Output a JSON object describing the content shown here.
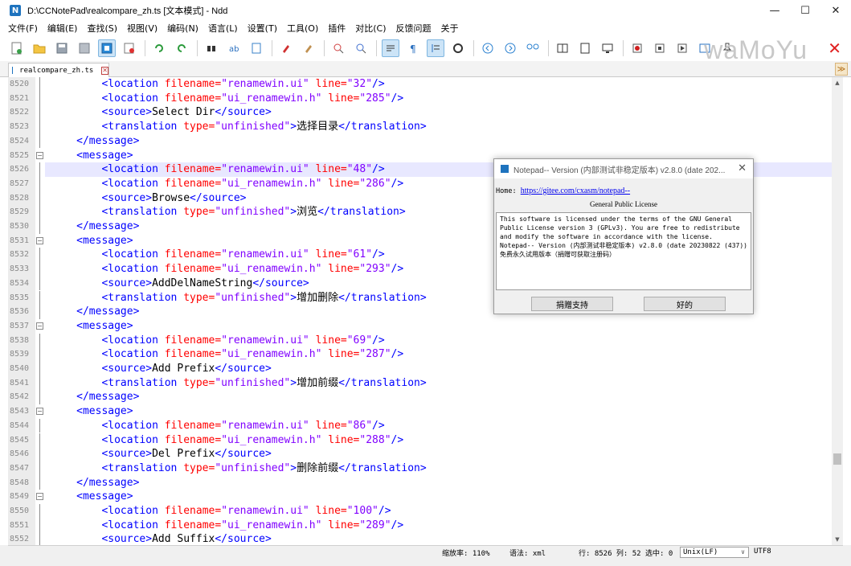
{
  "window": {
    "title": "D:\\CCNotePad\\realcompare_zh.ts [文本模式] - Ndd",
    "minimize": "—",
    "maximize": "☐",
    "close": "✕"
  },
  "menu": [
    "文件(F)",
    "编辑(E)",
    "查找(S)",
    "视图(V)",
    "编码(N)",
    "语言(L)",
    "设置(T)",
    "工具(O)",
    "插件",
    "对比(C)",
    "反馈问题",
    "关于"
  ],
  "watermark": "waMoYu",
  "tab": {
    "label": "realcompare_zh.ts"
  },
  "editor": {
    "lines": [
      {
        "n": "8520",
        "indent": 8,
        "parts": [
          [
            "tag",
            "<location "
          ],
          [
            "attr",
            "filename="
          ],
          [
            "val",
            "\"renamewin.ui\""
          ],
          [
            "attr",
            " line="
          ],
          [
            "val",
            "\"32\""
          ],
          [
            "tag",
            "/>"
          ]
        ]
      },
      {
        "n": "8521",
        "indent": 8,
        "parts": [
          [
            "tag",
            "<location "
          ],
          [
            "attr",
            "filename="
          ],
          [
            "val",
            "\"ui_renamewin.h\""
          ],
          [
            "attr",
            " line="
          ],
          [
            "val",
            "\"285\""
          ],
          [
            "tag",
            "/>"
          ]
        ]
      },
      {
        "n": "8522",
        "indent": 8,
        "parts": [
          [
            "tag",
            "<source>"
          ],
          [
            "txt",
            "Select Dir"
          ],
          [
            "tag",
            "</source>"
          ]
        ]
      },
      {
        "n": "8523",
        "indent": 8,
        "parts": [
          [
            "tag",
            "<translation "
          ],
          [
            "attr",
            "type="
          ],
          [
            "val",
            "\"unfinished\""
          ],
          [
            "tag",
            ">"
          ],
          [
            "txt",
            "选择目录"
          ],
          [
            "tag",
            "</translation>"
          ]
        ]
      },
      {
        "n": "8524",
        "indent": 4,
        "parts": [
          [
            "tag",
            "</message>"
          ]
        ]
      },
      {
        "n": "8525",
        "indent": 4,
        "parts": [
          [
            "tag",
            "<message>"
          ]
        ]
      },
      {
        "n": "8526",
        "indent": 8,
        "parts": [
          [
            "tag",
            "<location "
          ],
          [
            "attr",
            "filename="
          ],
          [
            "val",
            "\"renamewin.ui\""
          ],
          [
            "attr",
            " line="
          ],
          [
            "val",
            "\"48\""
          ],
          [
            "tag",
            "/>"
          ]
        ]
      },
      {
        "n": "8527",
        "indent": 8,
        "parts": [
          [
            "tag",
            "<location "
          ],
          [
            "attr",
            "filename="
          ],
          [
            "val",
            "\"ui_renamewin.h\""
          ],
          [
            "attr",
            " line="
          ],
          [
            "val",
            "\"286\""
          ],
          [
            "tag",
            "/>"
          ]
        ]
      },
      {
        "n": "8528",
        "indent": 8,
        "parts": [
          [
            "tag",
            "<source>"
          ],
          [
            "txt",
            "Browse"
          ],
          [
            "tag",
            "</source>"
          ]
        ]
      },
      {
        "n": "8529",
        "indent": 8,
        "parts": [
          [
            "tag",
            "<translation "
          ],
          [
            "attr",
            "type="
          ],
          [
            "val",
            "\"unfinished\""
          ],
          [
            "tag",
            ">"
          ],
          [
            "txt",
            "浏览"
          ],
          [
            "tag",
            "</translation>"
          ]
        ]
      },
      {
        "n": "8530",
        "indent": 4,
        "parts": [
          [
            "tag",
            "</message>"
          ]
        ]
      },
      {
        "n": "8531",
        "indent": 4,
        "parts": [
          [
            "tag",
            "<message>"
          ]
        ]
      },
      {
        "n": "8532",
        "indent": 8,
        "parts": [
          [
            "tag",
            "<location "
          ],
          [
            "attr",
            "filename="
          ],
          [
            "val",
            "\"renamewin.ui\""
          ],
          [
            "attr",
            " line="
          ],
          [
            "val",
            "\"61\""
          ],
          [
            "tag",
            "/>"
          ]
        ]
      },
      {
        "n": "8533",
        "indent": 8,
        "parts": [
          [
            "tag",
            "<location "
          ],
          [
            "attr",
            "filename="
          ],
          [
            "val",
            "\"ui_renamewin.h\""
          ],
          [
            "attr",
            " line="
          ],
          [
            "val",
            "\"293\""
          ],
          [
            "tag",
            "/>"
          ]
        ]
      },
      {
        "n": "8534",
        "indent": 8,
        "parts": [
          [
            "tag",
            "<source>"
          ],
          [
            "txt",
            "AddDelNameString"
          ],
          [
            "tag",
            "</source>"
          ]
        ]
      },
      {
        "n": "8535",
        "indent": 8,
        "parts": [
          [
            "tag",
            "<translation "
          ],
          [
            "attr",
            "type="
          ],
          [
            "val",
            "\"unfinished\""
          ],
          [
            "tag",
            ">"
          ],
          [
            "txt",
            "增加删除"
          ],
          [
            "tag",
            "</translation>"
          ]
        ]
      },
      {
        "n": "8536",
        "indent": 4,
        "parts": [
          [
            "tag",
            "</message>"
          ]
        ]
      },
      {
        "n": "8537",
        "indent": 4,
        "parts": [
          [
            "tag",
            "<message>"
          ]
        ]
      },
      {
        "n": "8538",
        "indent": 8,
        "parts": [
          [
            "tag",
            "<location "
          ],
          [
            "attr",
            "filename="
          ],
          [
            "val",
            "\"renamewin.ui\""
          ],
          [
            "attr",
            " line="
          ],
          [
            "val",
            "\"69\""
          ],
          [
            "tag",
            "/>"
          ]
        ]
      },
      {
        "n": "8539",
        "indent": 8,
        "parts": [
          [
            "tag",
            "<location "
          ],
          [
            "attr",
            "filename="
          ],
          [
            "val",
            "\"ui_renamewin.h\""
          ],
          [
            "attr",
            " line="
          ],
          [
            "val",
            "\"287\""
          ],
          [
            "tag",
            "/>"
          ]
        ]
      },
      {
        "n": "8540",
        "indent": 8,
        "parts": [
          [
            "tag",
            "<source>"
          ],
          [
            "txt",
            "Add Prefix"
          ],
          [
            "tag",
            "</source>"
          ]
        ]
      },
      {
        "n": "8541",
        "indent": 8,
        "parts": [
          [
            "tag",
            "<translation "
          ],
          [
            "attr",
            "type="
          ],
          [
            "val",
            "\"unfinished\""
          ],
          [
            "tag",
            ">"
          ],
          [
            "txt",
            "增加前缀"
          ],
          [
            "tag",
            "</translation>"
          ]
        ]
      },
      {
        "n": "8542",
        "indent": 4,
        "parts": [
          [
            "tag",
            "</message>"
          ]
        ]
      },
      {
        "n": "8543",
        "indent": 4,
        "parts": [
          [
            "tag",
            "<message>"
          ]
        ]
      },
      {
        "n": "8544",
        "indent": 8,
        "parts": [
          [
            "tag",
            "<location "
          ],
          [
            "attr",
            "filename="
          ],
          [
            "val",
            "\"renamewin.ui\""
          ],
          [
            "attr",
            " line="
          ],
          [
            "val",
            "\"86\""
          ],
          [
            "tag",
            "/>"
          ]
        ]
      },
      {
        "n": "8545",
        "indent": 8,
        "parts": [
          [
            "tag",
            "<location "
          ],
          [
            "attr",
            "filename="
          ],
          [
            "val",
            "\"ui_renamewin.h\""
          ],
          [
            "attr",
            " line="
          ],
          [
            "val",
            "\"288\""
          ],
          [
            "tag",
            "/>"
          ]
        ]
      },
      {
        "n": "8546",
        "indent": 8,
        "parts": [
          [
            "tag",
            "<source>"
          ],
          [
            "txt",
            "Del Prefix"
          ],
          [
            "tag",
            "</source>"
          ]
        ]
      },
      {
        "n": "8547",
        "indent": 8,
        "parts": [
          [
            "tag",
            "<translation "
          ],
          [
            "attr",
            "type="
          ],
          [
            "val",
            "\"unfinished\""
          ],
          [
            "tag",
            ">"
          ],
          [
            "txt",
            "删除前缀"
          ],
          [
            "tag",
            "</translation>"
          ]
        ]
      },
      {
        "n": "8548",
        "indent": 4,
        "parts": [
          [
            "tag",
            "</message>"
          ]
        ]
      },
      {
        "n": "8549",
        "indent": 4,
        "parts": [
          [
            "tag",
            "<message>"
          ]
        ]
      },
      {
        "n": "8550",
        "indent": 8,
        "parts": [
          [
            "tag",
            "<location "
          ],
          [
            "attr",
            "filename="
          ],
          [
            "val",
            "\"renamewin.ui\""
          ],
          [
            "attr",
            " line="
          ],
          [
            "val",
            "\"100\""
          ],
          [
            "tag",
            "/>"
          ]
        ]
      },
      {
        "n": "8551",
        "indent": 8,
        "parts": [
          [
            "tag",
            "<location "
          ],
          [
            "attr",
            "filename="
          ],
          [
            "val",
            "\"ui_renamewin.h\""
          ],
          [
            "attr",
            " line="
          ],
          [
            "val",
            "\"289\""
          ],
          [
            "tag",
            "/>"
          ]
        ]
      },
      {
        "n": "8552",
        "indent": 8,
        "parts": [
          [
            "tag",
            "<source>"
          ],
          [
            "txt",
            "Add Suffix"
          ],
          [
            "tag",
            "</source>"
          ]
        ]
      }
    ],
    "current_line": "8526",
    "fold_lines": [
      "8525",
      "8531",
      "8537",
      "8543",
      "8549"
    ]
  },
  "statusbar": {
    "zoom": "缩放率: 110%",
    "syntax": "语法: xml",
    "position": "行: 8526 列: 52 选中: 0",
    "eol": "Unix(LF)",
    "encoding": "UTF8"
  },
  "dialog": {
    "title": "Notepad-- Version (内部测试非稳定版本) v2.8.0 (date 202...",
    "home_label": "Home: ",
    "home_link": "https://gitee.com/cxasm/notepad--",
    "license_title": "General Public License",
    "license_text": "This software is licensed under the terms of the GNU General Public License version 3 (GPLv3). You are free to redistribute and modify the software in accordance with the license.\nNotepad-- Version (内部测试非稳定版本) v2.8.0 (date 20230822 (437))\n免费永久试用版本（捐赠可获取注册码）",
    "donate_button": "捐赠支持",
    "ok_button": "好的"
  }
}
